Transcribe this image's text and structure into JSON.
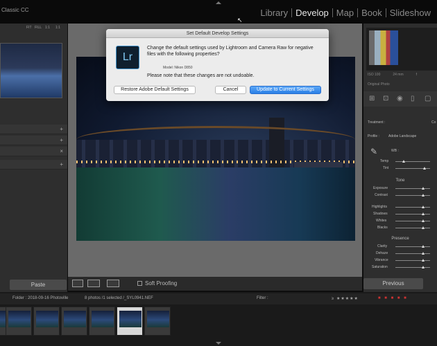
{
  "app": {
    "brand": "Classic CC"
  },
  "modules": [
    {
      "label": "Library",
      "active": false
    },
    {
      "label": "Develop",
      "active": true
    },
    {
      "label": "Map",
      "active": false
    },
    {
      "label": "Book",
      "active": false
    },
    {
      "label": "Slideshow",
      "active": false
    }
  ],
  "navigator": {
    "fit": "FIT",
    "fill": "FILL",
    "r1": "1:1",
    "r2": "1:1"
  },
  "left_panel": {
    "paste_label": "Paste",
    "row_marks": [
      "+",
      "+",
      "×",
      "+"
    ]
  },
  "toolbar": {
    "soft_proofing": "Soft Proofing"
  },
  "histogram": {
    "iso": "ISO 100",
    "focal": "24 mm",
    "aperture": "f"
  },
  "right_panel": {
    "original_photo": "Original Photo",
    "treatment_label": "Treatment :",
    "treatment_value": "Co",
    "profile_label": "Profile :",
    "profile_value": "Adobe Landscape",
    "wb_label": "WB :",
    "temp": "Temp",
    "tint": "Tint",
    "tone": "Tone",
    "exposure": "Exposure",
    "contrast": "Contrast",
    "highlights": "Highlights",
    "shadows": "Shadows",
    "whites": "Whites",
    "blacks": "Blacks",
    "presence": "Presence",
    "clarity": "Clarity",
    "dehaze": "Dehaze",
    "vibrance": "Vibrance",
    "saturation": "Saturation",
    "previous": "Previous"
  },
  "filmstrip": {
    "folder": "Folder : 2018-09-16 Photoville",
    "count": "8 photos /1 selected /_SYL0941.NEF",
    "filter": "Filter :"
  },
  "dialog": {
    "title": "Set Default Develop Settings",
    "logo": "Lr",
    "message": "Change the default settings used by Lightroom and Camera Raw for negative files with the following properties?",
    "model": "Model:  Nikon D850",
    "note": "Please note that these changes are not undoable.",
    "restore": "Restore Adobe Default Settings",
    "cancel": "Cancel",
    "update": "Update to Current Settings"
  }
}
